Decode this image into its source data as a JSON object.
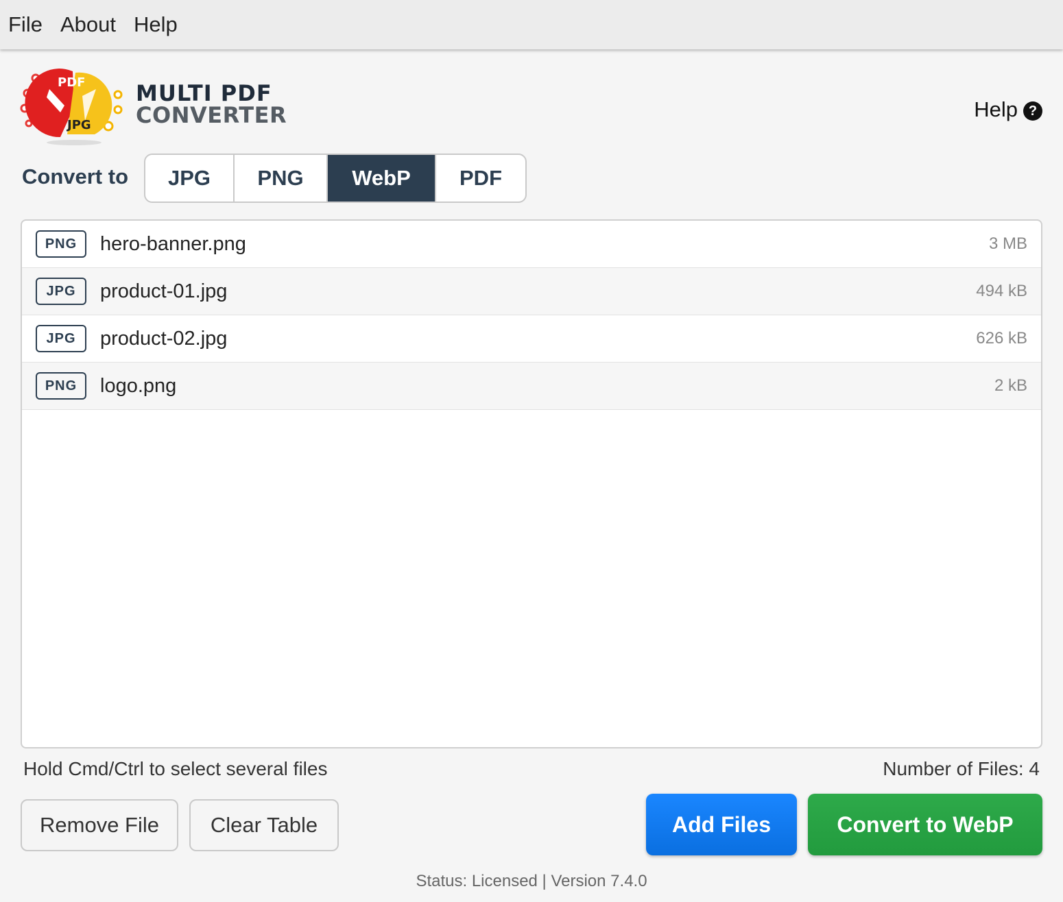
{
  "menu": {
    "items": [
      "File",
      "About",
      "Help"
    ]
  },
  "logo": {
    "badge_top": "PDF",
    "badge_bottom": "JPG",
    "line1": "MULTI PDF",
    "line2": "CONVERTER"
  },
  "help": {
    "label": "Help",
    "icon": "?"
  },
  "convert": {
    "label": "Convert to",
    "formats": [
      "JPG",
      "PNG",
      "WebP",
      "PDF"
    ],
    "selected": "WebP"
  },
  "files": [
    {
      "type": "PNG",
      "name": "hero-banner.png",
      "size": "3 MB"
    },
    {
      "type": "JPG",
      "name": "product-01.jpg",
      "size": "494 kB"
    },
    {
      "type": "JPG",
      "name": "product-02.jpg",
      "size": "626 kB"
    },
    {
      "type": "PNG",
      "name": "logo.png",
      "size": "2 kB"
    }
  ],
  "footer": {
    "hint": "Hold Cmd/Ctrl to select several files",
    "count": "Number of Files: 4",
    "remove_label": "Remove File",
    "clear_label": "Clear Table",
    "add_label": "Add Files",
    "convert_label": "Convert to WebP",
    "status": "Status: Licensed | Version 7.4.0"
  },
  "colors": {
    "accent_dark": "#2c3e50",
    "add_blue": "#0a6fe0",
    "convert_green": "#229b3e"
  }
}
